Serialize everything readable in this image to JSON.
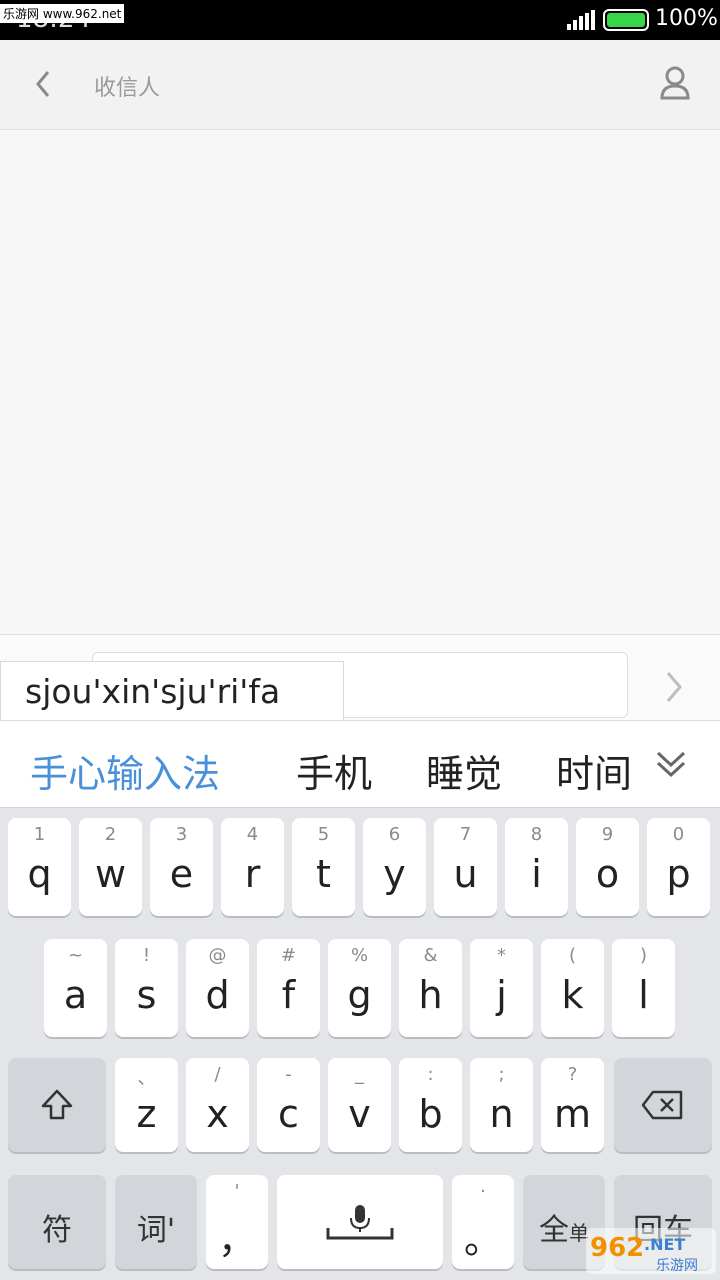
{
  "status_bar": {
    "time": "18:24",
    "battery": "100%",
    "watermark": "乐游网 www.962.net"
  },
  "title_bar": {
    "title": "收信人",
    "icons": {
      "back": "chevron-left-icon",
      "contact": "person-icon"
    }
  },
  "compose": {
    "message_value": "",
    "send_icon": "chevron-right-icon"
  },
  "ime": {
    "pinyin": "sjou'xin'sju'ri'fa",
    "candidates": [
      "手心输入法",
      "手机",
      "睡觉",
      "时间"
    ],
    "expand_icon": "double-chevron-down-icon",
    "row1": [
      {
        "sub": "1",
        "main": "q"
      },
      {
        "sub": "2",
        "main": "w"
      },
      {
        "sub": "3",
        "main": "e"
      },
      {
        "sub": "4",
        "main": "r"
      },
      {
        "sub": "5",
        "main": "t"
      },
      {
        "sub": "6",
        "main": "y"
      },
      {
        "sub": "7",
        "main": "u"
      },
      {
        "sub": "8",
        "main": "i"
      },
      {
        "sub": "9",
        "main": "o"
      },
      {
        "sub": "0",
        "main": "p"
      }
    ],
    "row2": [
      {
        "sub": "~",
        "main": "a"
      },
      {
        "sub": "!",
        "main": "s"
      },
      {
        "sub": "@",
        "main": "d"
      },
      {
        "sub": "#",
        "main": "f"
      },
      {
        "sub": "%",
        "main": "g"
      },
      {
        "sub": "&",
        "main": "h"
      },
      {
        "sub": "*",
        "main": "j"
      },
      {
        "sub": "(",
        "main": "k"
      },
      {
        "sub": ")",
        "main": "l"
      }
    ],
    "row3": [
      {
        "sub": "、",
        "main": "z"
      },
      {
        "sub": "/",
        "main": "x"
      },
      {
        "sub": "-",
        "main": "c"
      },
      {
        "sub": "_",
        "main": "v"
      },
      {
        "sub": ":",
        "main": "b"
      },
      {
        "sub": ";",
        "main": "n"
      },
      {
        "sub": "?",
        "main": "m"
      }
    ],
    "row4": {
      "symbol": "符",
      "word": "词'",
      "comma_sub": "'",
      "comma": "，",
      "period_sub": "·",
      "period": "。",
      "fullhalf": "全",
      "fullhalf_small": "单",
      "enter": "回车"
    },
    "shift_icon": "shift-icon",
    "delete_icon": "backspace-icon",
    "space_icon": "microphone-icon"
  },
  "watermark_bottom": {
    "number": "962",
    "net": ".NET",
    "name": "乐游网"
  },
  "colors": {
    "accent": "#4a90d9",
    "battery": "#37d64a"
  }
}
